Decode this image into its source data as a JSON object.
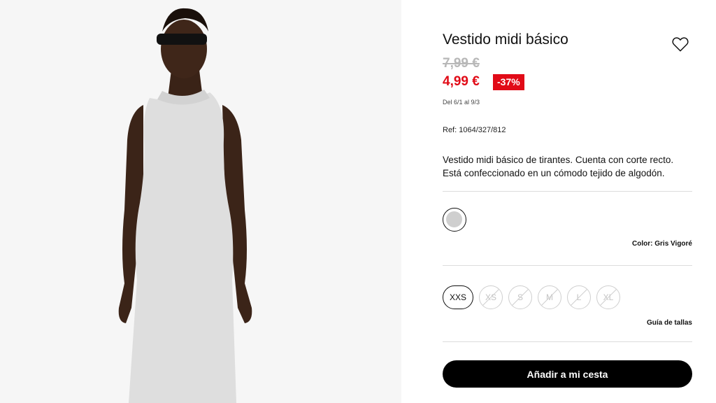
{
  "product": {
    "title": "Vestido midi básico",
    "old_price": "7,99 €",
    "new_price": "4,99 €",
    "discount": "-37%",
    "dates": "Del 6/1 al 9/3",
    "ref": "Ref: 1064/327/812",
    "description": "Vestido midi básico de tirantes. Cuenta con corte recto. Está confeccionado en un cómodo tejido de algodón.",
    "color_label": "Color: Gris Vigoré",
    "swatch_color": "#cfcfcf",
    "sizes": [
      {
        "label": "XXS",
        "available": true,
        "selected": true
      },
      {
        "label": "XS",
        "available": false
      },
      {
        "label": "S",
        "available": false
      },
      {
        "label": "M",
        "available": false
      },
      {
        "label": "L",
        "available": false
      },
      {
        "label": "XL",
        "available": false
      }
    ],
    "size_guide": "Guía de tallas",
    "add_to_cart": "Añadir a mi cesta"
  },
  "colors": {
    "accent_red": "#e10b17",
    "button_black": "#000000"
  },
  "icons": {
    "favorite": "heart-icon"
  }
}
